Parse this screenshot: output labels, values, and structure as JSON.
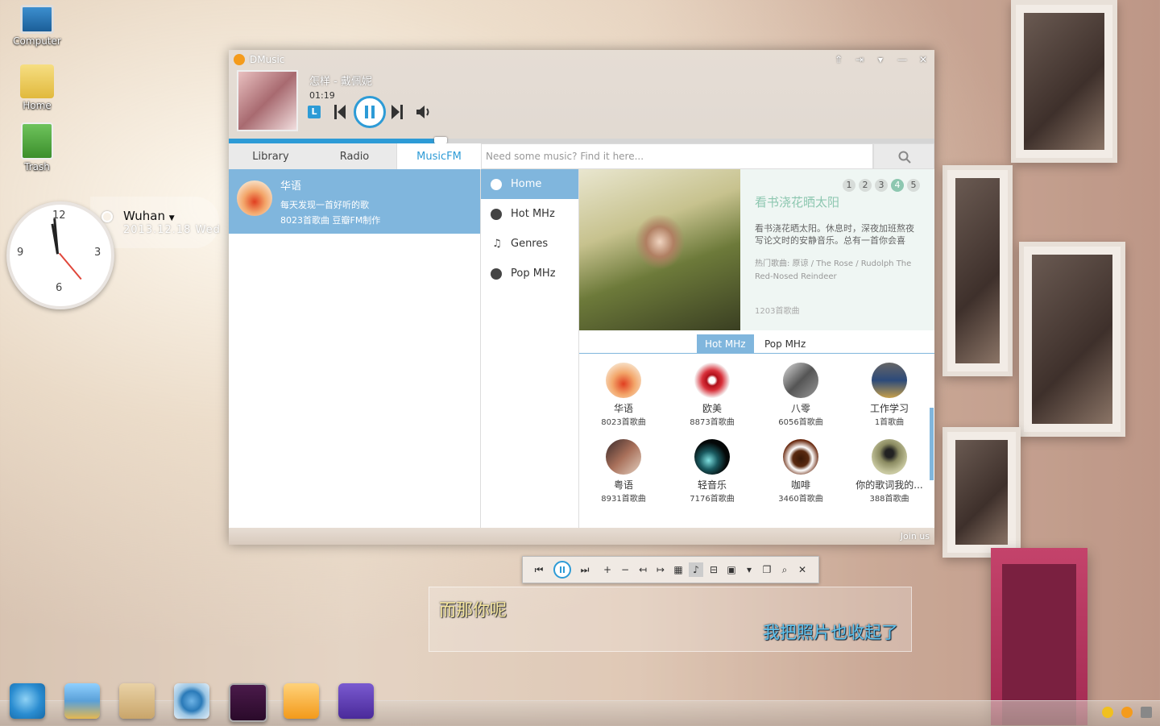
{
  "desktop": {
    "icons": [
      {
        "label": "Computer"
      },
      {
        "label": "Home"
      },
      {
        "label": "Trash"
      }
    ],
    "clock": {
      "city": "Wuhan",
      "date": "2013.12.18 Wed",
      "numerals": [
        "12",
        "3",
        "6",
        "9"
      ]
    }
  },
  "player": {
    "title": "DMusic",
    "song": "怎样 - 戴佩妮",
    "elapsed": "01:19",
    "lyric_mode_label": "L",
    "progress_fraction": 0.3,
    "tabs": [
      {
        "label": "Library"
      },
      {
        "label": "Radio"
      },
      {
        "label": "MusicFM"
      }
    ],
    "search": {
      "placeholder": "Need some music? Find it here..."
    },
    "station": {
      "name": "华语",
      "desc": "每天发现一首好听的歌",
      "meta": "8023首歌曲 豆瓣FM制作"
    },
    "nav": [
      {
        "label": "Home",
        "icon": "home-icon"
      },
      {
        "label": "Hot MHz",
        "icon": "hot-icon"
      },
      {
        "label": "Genres",
        "icon": "music-note-icon"
      },
      {
        "label": "Pop MHz",
        "icon": "smiley-icon"
      }
    ],
    "banner": {
      "pages": [
        "1",
        "2",
        "3",
        "4",
        "5"
      ],
      "active_page": "4",
      "title": "看书浇花晒太阳",
      "desc": "看书浇花晒太阳。休息时，深夜加班熬夜写论文时的安静音乐。总有一首你会喜",
      "hot": "热门歌曲: 原谅 / The Rose / Rudolph The Red-Nosed Reindeer",
      "count": "1203首歌曲"
    },
    "subtabs": [
      {
        "label": "Hot MHz"
      },
      {
        "label": "Pop MHz"
      }
    ],
    "channels": [
      {
        "name": "华语",
        "count": "8023首歌曲"
      },
      {
        "name": "欧美",
        "count": "8873首歌曲"
      },
      {
        "name": "八零",
        "count": "6056首歌曲"
      },
      {
        "name": "工作学习",
        "count": "1首歌曲"
      },
      {
        "name": "粤语",
        "count": "8931首歌曲"
      },
      {
        "name": "轻音乐",
        "count": "7176首歌曲"
      },
      {
        "name": "咖啡",
        "count": "3460首歌曲"
      },
      {
        "name": "你的歌词我的...",
        "count": "388首歌曲"
      }
    ],
    "footer": {
      "join": "Join us"
    }
  },
  "lyrics": {
    "line1": "而那你呢",
    "line2": "我把照片也收起了"
  },
  "colors": {
    "accent": "#2d9bd6",
    "selection": "#80b6dd",
    "banner_accent": "#8dc7b0"
  }
}
